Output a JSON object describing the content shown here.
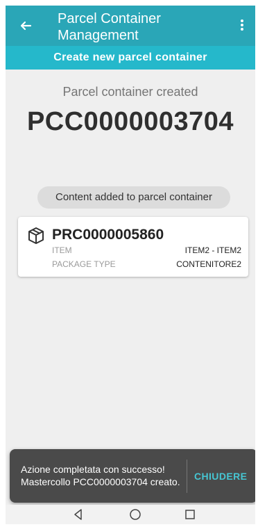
{
  "header": {
    "title": "Parcel Container Management",
    "subtitle": "Create new parcel container"
  },
  "status": {
    "created_label": "Parcel container created",
    "container_code": "PCC0000003704"
  },
  "chip": {
    "text": "Content added to parcel container"
  },
  "card": {
    "code": "PRC0000005860",
    "item_label": "ITEM",
    "item_value": "ITEM2 - ITEM2",
    "package_type_label": "PACKAGE TYPE",
    "package_type_value": "CONTENITORE2"
  },
  "snackbar": {
    "message": "Azione completata con successo! Mastercollo PCC0000003704 creato.",
    "action": "CHIUDERE"
  },
  "icons": {
    "back": "arrow-left-icon",
    "menu": "more-vertical-icon",
    "box": "package-icon",
    "nav_back": "triangle-back-icon",
    "nav_home": "circle-home-icon",
    "nav_recent": "square-recent-icon"
  },
  "colors": {
    "appbar": "#2aa6b7",
    "subbar": "#25b8cb",
    "accent": "#46c6d3"
  }
}
